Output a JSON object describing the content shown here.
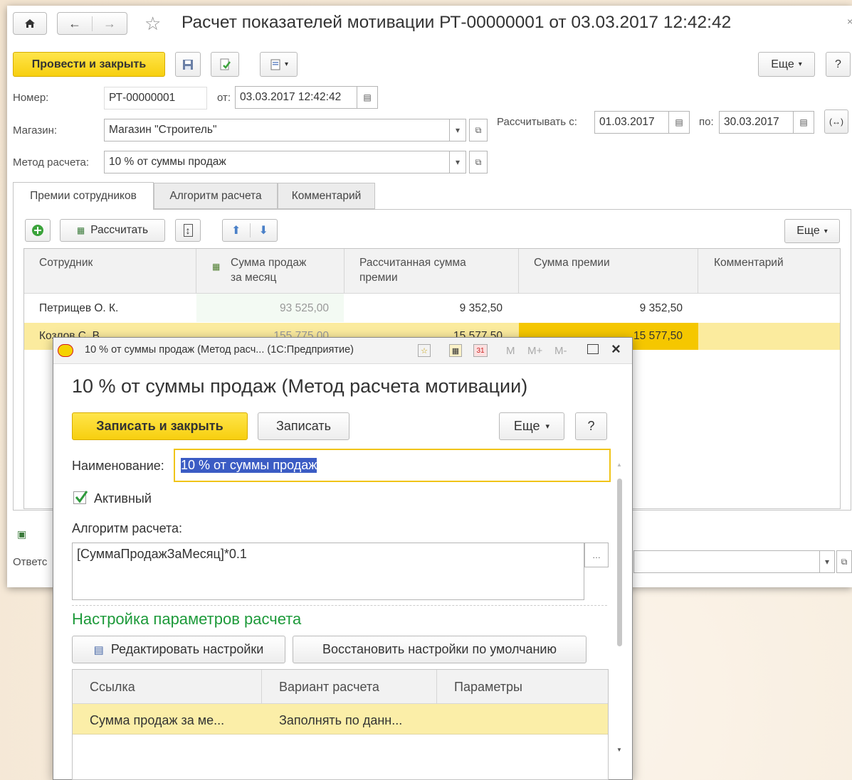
{
  "main": {
    "title": "Расчет показателей мотивации РТ-00000001 от 03.03.2017 12:42:42",
    "toolbar": {
      "post_close": "Провести и закрыть",
      "more": "Еще",
      "help": "?"
    },
    "fields": {
      "number_label": "Номер:",
      "number_value": "РТ-00000001",
      "from_label": "от:",
      "from_value": "03.03.2017 12:42:42",
      "store_label": "Магазин:",
      "store_value": "Магазин  \"Строитель\"",
      "method_label": "Метод расчета:",
      "method_value": "10 % от суммы продаж",
      "calc_from_label": "Рассчитывать с:",
      "calc_from_value": "01.03.2017",
      "calc_to_label": "по:",
      "calc_to_value": "30.03.2017"
    },
    "tabs": [
      "Премии сотрудников",
      "Алгоритм расчета",
      "Комментарий"
    ],
    "table_toolbar": {
      "calculate": "Рассчитать",
      "more": "Еще"
    },
    "table": {
      "columns": [
        "Сотрудник",
        "Сумма продаж за месяц",
        "Рассчитанная сумма премии",
        "Сумма премии",
        "Комментарий"
      ],
      "col2_line1": "Сумма продаж",
      "col2_line2": "за месяц",
      "col3_line1": "Рассчитанная сумма",
      "col3_line2": "премии",
      "rows": [
        {
          "employee": "Петрищев О. К.",
          "sales": "93 525,00",
          "calc": "9 352,50",
          "bonus": "9 352,50",
          "comment": ""
        },
        {
          "employee": "Козлов С. В.",
          "sales": "155 775,00",
          "calc": "15 577,50",
          "bonus": "15 577,50",
          "comment": ""
        }
      ]
    },
    "responsible_label": "Ответс"
  },
  "dialog": {
    "window_title": "10 % от суммы продаж (Метод расч... (1С:Предприятие)",
    "window_controls": {
      "m": "M",
      "mplus": "M+",
      "mminus": "M-"
    },
    "heading": "10 % от суммы продаж (Метод расчета мотивации)",
    "toolbar": {
      "save_close": "Записать и закрыть",
      "save": "Записать",
      "more": "Еще",
      "help": "?"
    },
    "name_label": "Наименование:",
    "name_value": "10 % от суммы продаж",
    "active_label": "Активный",
    "algorithm_label": "Алгоритм расчета:",
    "algorithm_value": "[СуммаПродажЗаМесяц]*0.1",
    "params_heading": "Настройка параметров расчета",
    "edit_settings": "Редактировать настройки",
    "restore_defaults": "Восстановить настройки по умолчанию",
    "table": {
      "columns": [
        "Ссылка",
        "Вариант расчета",
        "Параметры"
      ],
      "rows": [
        {
          "link": "Сумма продаж за ме...",
          "variant": "Заполнять по данн...",
          "params": ""
        }
      ]
    },
    "colors": {
      "params_heading": "#1d9a3a",
      "accent_yellow": "#f7cf0f",
      "selection": "#3b5cc4"
    }
  }
}
